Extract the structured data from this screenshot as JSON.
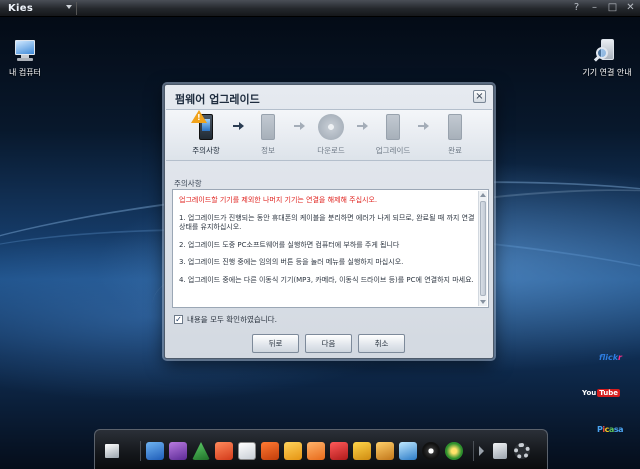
{
  "app": {
    "logo": "Kies",
    "window_controls": [
      "?",
      "–",
      "□",
      "✕"
    ]
  },
  "desktop": {
    "my_computer_label": "내 컴퓨터",
    "connection_guide_label": "기기 연결 안내"
  },
  "services": {
    "flickr_a": "flick",
    "flickr_b": "r",
    "youtube_a": "You",
    "youtube_b": "Tube",
    "picasa": [
      "P",
      "i",
      "c",
      "a",
      "sa"
    ]
  },
  "dialog": {
    "title": "펌웨어 업그레이드",
    "close": "×",
    "steps": [
      {
        "label": "주의사항",
        "active": true
      },
      {
        "label": "정보",
        "active": false
      },
      {
        "label": "다운로드",
        "active": false
      },
      {
        "label": "업그레이드",
        "active": false
      },
      {
        "label": "완료",
        "active": false
      }
    ],
    "warning_mark": "!",
    "section_label": "주의사항",
    "notice": {
      "warning": "업그레이드할 기기를 제외한 나머지 기기는 연결을 해제해 주십시오.",
      "items": [
        "1. 업그레이드가 진행되는 동안 휴대폰의 케이블을 분리하면 에러가 나게 되므로, 완료될 때 까지 연결 상태를 유지하십시오.",
        "2. 업그레이드 도중 PC소프트웨어를 실행하면 컴퓨터에 부하를 주게 됩니다",
        "3. 업그레이드 진행 중에는 임의의 버튼 등을 눌러 메뉴를 실행하지 마십시오.",
        "4. 업그레이드 중에는 다른 이동식 기기(MP3, 카메라, 이동식 드라이브 등)를 PC에 연결하지 마세요."
      ]
    },
    "confirm_checked": "✓",
    "confirm_label": "내용을 모두 확인하였습니다.",
    "buttons": {
      "back": "뒤로",
      "next": "다음",
      "cancel": "취소"
    }
  },
  "dock": {
    "icons": [
      "export-icon",
      "photo-icon",
      "video-icon",
      "music-icon",
      "contacts-icon",
      "calendar-icon",
      "notes-icon",
      "messages-icon",
      "podcast-icon",
      "schedule-icon",
      "gallery-icon",
      "image-icon",
      "image-edit-icon",
      "disc-icon",
      "globe-icon",
      "device-icon",
      "settings-icon"
    ]
  }
}
